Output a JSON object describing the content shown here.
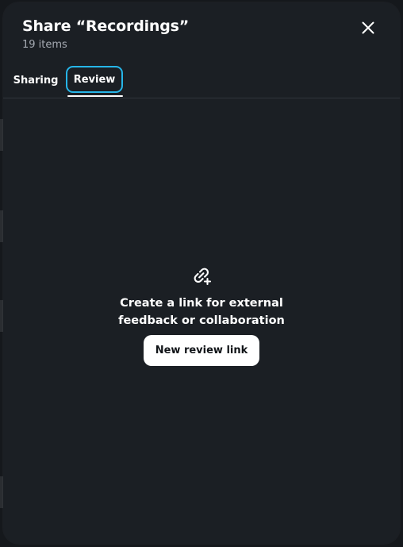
{
  "dialog": {
    "title": "Share “Recordings”",
    "subtitle": "19 items",
    "close_icon": "close-icon"
  },
  "tabs": [
    {
      "label": "Sharing",
      "selected": false
    },
    {
      "label": "Review",
      "selected": true
    }
  ],
  "empty_state": {
    "icon": "link-add-icon",
    "message": "Create a link for external feedback or collaboration",
    "button_label": "New review link"
  },
  "colors": {
    "modal_background": "#1b1f24",
    "focus_ring": "#26b5e8",
    "primary_button": "#ffffff"
  }
}
